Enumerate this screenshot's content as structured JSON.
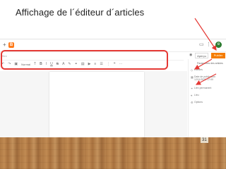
{
  "slide": {
    "title": "Affichage de l´éditeur d´articles",
    "page_number": "31"
  },
  "editor": {
    "title_placeholder": "Titre",
    "toolbar_font": "Normal",
    "update_button": "Publier",
    "view_select": "Aperçu",
    "sidebar": {
      "header": "Paramètres des articles",
      "items": [
        {
          "icon": "label-icon",
          "label": "Libellés"
        },
        {
          "icon": "calendar-icon",
          "label": "Date de publication 12/11/2022 17:00"
        },
        {
          "icon": "link-icon",
          "label": "Lien permanent"
        },
        {
          "icon": "location-icon",
          "label": "Lieu"
        },
        {
          "icon": "options-icon",
          "label": "Options"
        }
      ]
    }
  },
  "colors": {
    "annotation": "#e53935",
    "blogger": "#ff7a1a",
    "publish": "#f57c00"
  }
}
